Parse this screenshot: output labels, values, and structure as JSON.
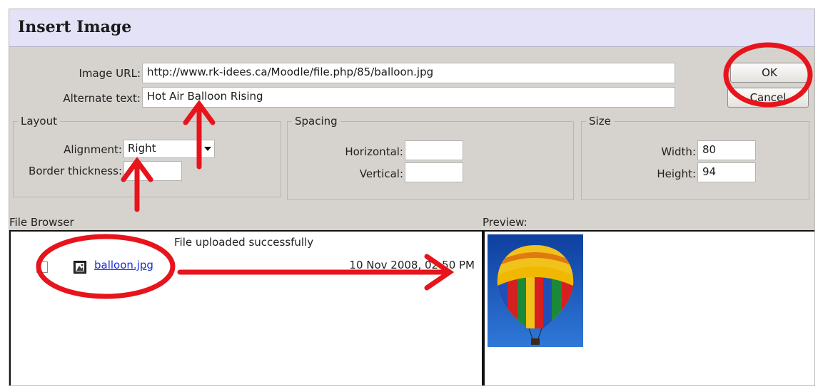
{
  "dialog": {
    "title": "Insert Image"
  },
  "fields": {
    "image_url_label": "Image URL:",
    "image_url_value": "http://www.rk-idees.ca/Moodle/file.php/85/balloon.jpg",
    "alt_text_label": "Alternate text:",
    "alt_text_value": "Hot Air Balloon Rising"
  },
  "buttons": {
    "ok": "OK",
    "cancel": "Cancel"
  },
  "layout_group": {
    "legend": "Layout",
    "alignment_label": "Alignment:",
    "alignment_value": "Right",
    "border_label": "Border thickness:",
    "border_value": ""
  },
  "spacing_group": {
    "legend": "Spacing",
    "horizontal_label": "Horizontal:",
    "horizontal_value": "",
    "vertical_label": "Vertical:",
    "vertical_value": ""
  },
  "size_group": {
    "legend": "Size",
    "width_label": "Width:",
    "width_value": "80",
    "height_label": "Height:",
    "height_value": "94"
  },
  "file_browser": {
    "label": "File Browser",
    "status": "File uploaded successfully",
    "files": [
      {
        "name": "balloon.jpg",
        "date": "10 Nov 2008, 02:50 PM"
      }
    ]
  },
  "preview": {
    "label": "Preview:"
  },
  "colors": {
    "dialog_bg": "#d6d3ce",
    "title_bg": "#e3e2f7",
    "annotation_red": "#e8141c",
    "link_blue": "#1a2fd0"
  }
}
